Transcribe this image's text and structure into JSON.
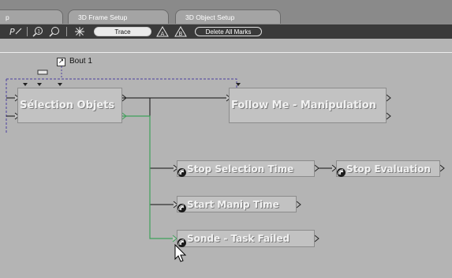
{
  "tabs": [
    {
      "label": "p"
    },
    {
      "label": "3D Frame Setup"
    },
    {
      "label": "3D Object Setup"
    }
  ],
  "toolbar": {
    "icons": [
      "parameter-icon",
      "zoom-in-icon",
      "zoom-out-icon",
      "sparkle-icon",
      "mark-a-icon",
      "mark-b-icon"
    ],
    "trace_label": "Trace",
    "delete_label": "Delete All Marks"
  },
  "schematic": {
    "bout_label": "Bout 1",
    "blocks": {
      "selection_objets": "Sélection Objets",
      "follow_me": "Follow Me - Manipulation",
      "stop_selection_time": "Stop Selection Time",
      "stop_evaluation": "Stop Evaluation",
      "start_manip_time": "Start Manip Time",
      "sonde_task_failed": "Sonde - Task Failed"
    }
  },
  "colors": {
    "canvas": "#b4b4b4",
    "wire": "#111111",
    "active_wire": "#3fa05a",
    "selection_dash": "#4b3fa0"
  }
}
